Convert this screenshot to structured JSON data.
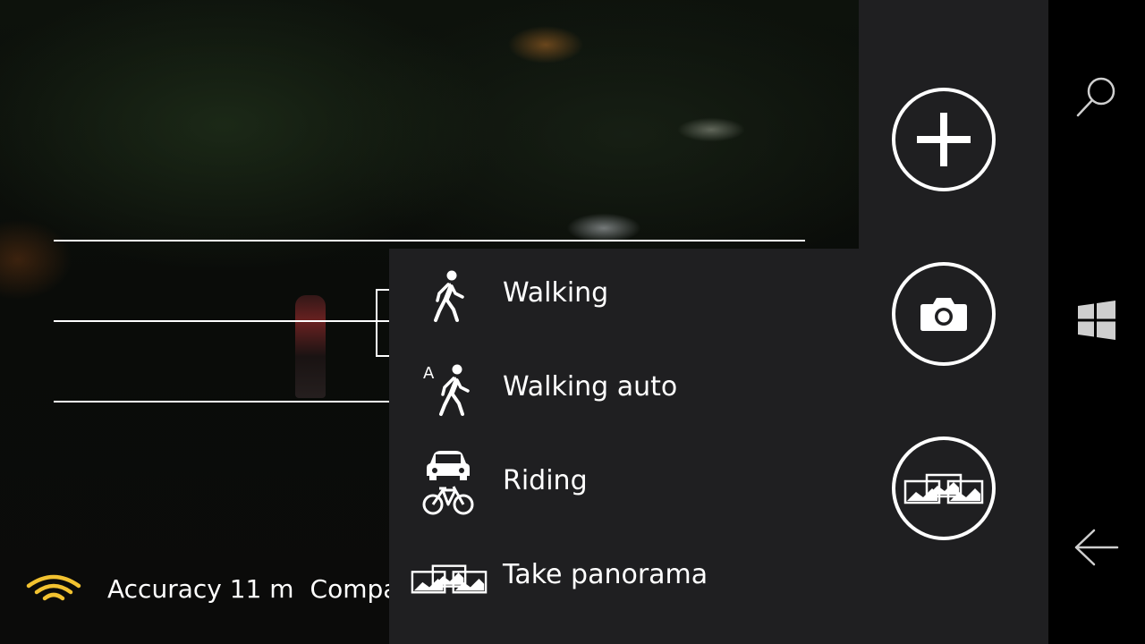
{
  "status": {
    "accuracy": "Accuracy 11 m",
    "compass": "Compass"
  },
  "menu": {
    "items": [
      {
        "label": "Walking",
        "icon": "walking-icon"
      },
      {
        "label": "Walking auto",
        "icon": "walking-auto-icon"
      },
      {
        "label": "Riding",
        "icon": "car-bike-icon"
      },
      {
        "label": "Take panorama",
        "icon": "panorama-icon"
      }
    ],
    "walking_auto_letter": "A"
  },
  "side_buttons": [
    {
      "icon": "add-icon"
    },
    {
      "icon": "camera-icon"
    },
    {
      "icon": "panorama-icon"
    }
  ],
  "nav": [
    {
      "icon": "search-icon"
    },
    {
      "icon": "windows-start-icon"
    },
    {
      "icon": "back-arrow-icon"
    }
  ],
  "colors": {
    "panel": "#1f1f21",
    "signal": "#f2c230",
    "foreground": "#ffffff"
  }
}
